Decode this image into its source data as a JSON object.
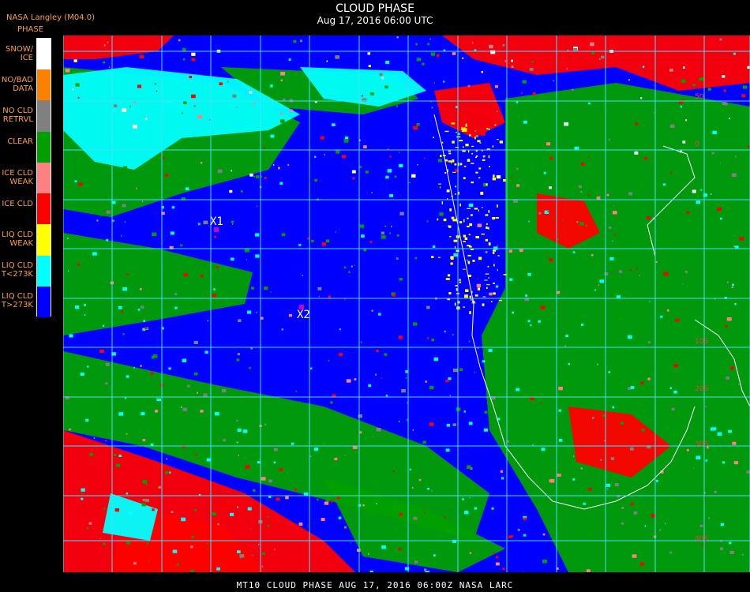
{
  "header": {
    "title": "CLOUD PHASE",
    "subtitle": "Aug 17, 2016 06:00 UTC",
    "provider": "NASA Langley (M04.0)"
  },
  "legend": {
    "title": "PHASE",
    "items": [
      {
        "label": "SNOW/\nICE",
        "color": "#ffffff"
      },
      {
        "label": "NO/BAD\nDATA",
        "color": "#ff7f00"
      },
      {
        "label": "NO CLD\nRETRVL",
        "color": "#808080"
      },
      {
        "label": "CLEAR",
        "color": "#00a000"
      },
      {
        "label": "ICE CLD\nWEAK",
        "color": "#ff8080"
      },
      {
        "label": "ICE CLD",
        "color": "#ff0000"
      },
      {
        "label": "LIQ CLD\nWEAK",
        "color": "#ffff00"
      },
      {
        "label": "LIQ CLD\nT<273K",
        "color": "#00ffff"
      },
      {
        "label": "LIQ CLD\nT>273K",
        "color": "#0000ff"
      }
    ]
  },
  "markers": [
    {
      "label": "X1",
      "color": "#cc00cc"
    },
    {
      "label": "X2",
      "color": "#cc00cc"
    }
  ],
  "map": {
    "grid_color": "#40e0ff",
    "coast_color": "#ffffff",
    "lat_labels": [
      "50",
      "0",
      "10S",
      "20S",
      "30S",
      "40S"
    ]
  },
  "footer": {
    "text": "MT10  CLOUD PHASE   AUG 17, 2016 06:00Z   NASA LARC"
  }
}
